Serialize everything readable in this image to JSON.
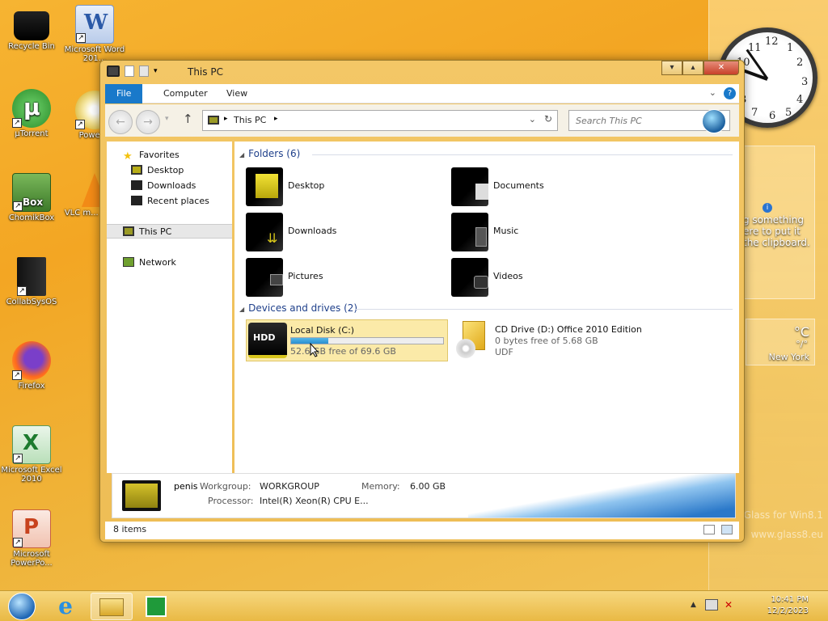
{
  "desktop": {
    "icons": [
      {
        "label": "Recycle Bin"
      },
      {
        "label": "Microsoft Word 201..."
      },
      {
        "label": "µTorrent"
      },
      {
        "label": "Power..."
      },
      {
        "label": "ChomikBox"
      },
      {
        "label": "VLC m... play..."
      },
      {
        "label": "CollabSysOS"
      },
      {
        "label": "Firefox"
      },
      {
        "label": "Microsoft Excel 2010"
      },
      {
        "label": "Microsoft PowerPo..."
      }
    ],
    "watermark": {
      "line1": "Glass for Win8.1",
      "line2": "www.glass8.eu"
    }
  },
  "gadgets": {
    "clock_numbers": [
      "12",
      "1",
      "2",
      "3",
      "4",
      "5",
      "6",
      "7",
      "8",
      "9",
      "10",
      "11"
    ],
    "clipboard_text": "g something ere to put it the clipboard.",
    "weather": {
      "unit": "°C",
      "value": "°/°",
      "city": "New York"
    }
  },
  "window": {
    "title": "This PC",
    "ribbon_tabs": [
      "File",
      "Computer",
      "View"
    ],
    "help_glyph": "?",
    "address": "This PC",
    "search_placeholder": "Search This PC",
    "nav": {
      "favorites": "Favorites",
      "desktop": "Desktop",
      "downloads": "Downloads",
      "recent": "Recent places",
      "this_pc": "This PC",
      "network": "Network"
    },
    "folders_header": "Folders (6)",
    "folders": [
      "Desktop",
      "Documents",
      "Downloads",
      "Music",
      "Pictures",
      "Videos"
    ],
    "devices_header": "Devices and drives (2)",
    "drives": [
      {
        "name": "Local Disk (C:)",
        "free_text": "52.6 GB free of 69.6 GB",
        "used_fraction": 0.244,
        "icon_label": "HDD"
      },
      {
        "name": "CD Drive (D:) Office 2010 Edition",
        "free_text": "0 bytes free of 5.68 GB",
        "fs": "UDF"
      }
    ],
    "details": {
      "computer_name": "penis",
      "workgroup_label": "Workgroup:",
      "workgroup_value": "WORKGROUP",
      "memory_label": "Memory:",
      "memory_value": "6.00 GB",
      "processor_label": "Processor:",
      "processor_value": "Intel(R) Xeon(R) CPU E..."
    },
    "status": "8 items"
  },
  "taskbar": {
    "time": "10:41 PM",
    "date": "12/2/2023"
  },
  "colors": {
    "accent": "#1979ca",
    "folder_yellow": "#e3d21a",
    "taskbar": "#f1c95e"
  }
}
